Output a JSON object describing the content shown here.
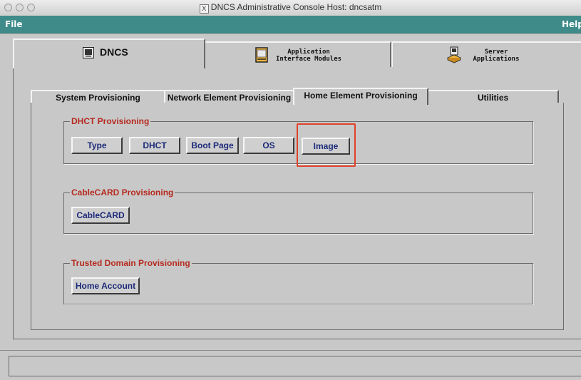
{
  "window": {
    "title": "DNCS Administrative Console  Host: dncsatm",
    "title_glyph": "X"
  },
  "menubar": {
    "file_label": "File",
    "help_label": "Help",
    "background": "#3e8b8a"
  },
  "outer_tabs": [
    {
      "label": "DNCS",
      "icon": "monitor-icon",
      "active": true
    },
    {
      "label_line1": "Application",
      "label_line2": "Interface Modules",
      "icon": "document-icon"
    },
    {
      "label_line1": "Server",
      "label_line2": "Applications",
      "icon": "server-icon"
    }
  ],
  "inner_tabs": [
    {
      "label": "System Provisioning"
    },
    {
      "label": "Network Element Provisioning"
    },
    {
      "label": "Home Element Provisioning",
      "active": true
    },
    {
      "label": "Utilities"
    }
  ],
  "groups": {
    "dhct": {
      "legend": "DHCT Provisioning",
      "buttons": [
        "Type",
        "DHCT",
        "Boot Page",
        "OS",
        "Image"
      ],
      "highlighted": "Image"
    },
    "cablecard": {
      "legend": "CableCARD Provisioning",
      "buttons": [
        "CableCARD"
      ]
    },
    "trusted": {
      "legend": "Trusted Domain Provisioning",
      "buttons": [
        "Home Account"
      ]
    }
  },
  "colors": {
    "legend_text": "#b52a1f",
    "button_text": "#1c2a7a",
    "highlight": "#e0412b",
    "panel_bg": "#c8c8c8"
  }
}
